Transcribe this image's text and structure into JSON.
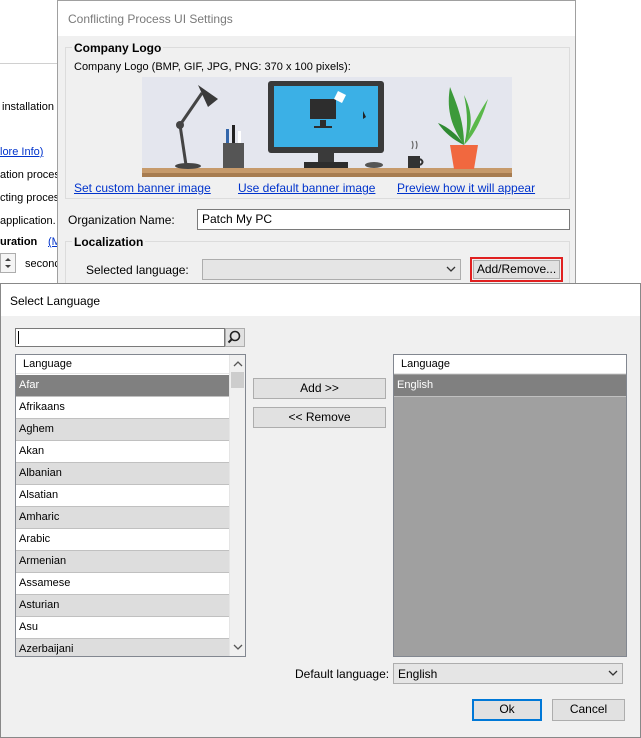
{
  "background_window": {
    "lines": [
      "installation c",
      "ation proces",
      "cting proces",
      "application.",
      "uration",
      "seconc"
    ],
    "more_info_link": "lore Info)",
    "m_link": "(M"
  },
  "conflicting_window": {
    "title": "Conflicting Process UI Settings",
    "company_logo_group": "Company Logo",
    "logo_caption": "Company Logo (BMP, GIF, JPG, PNG: 370 x 100 pixels):",
    "links": {
      "set_custom": "Set custom banner image",
      "use_default": "Use default banner image",
      "preview": "Preview how it will appear"
    },
    "org_label": "Organization Name:",
    "org_value": "Patch My PC",
    "localization_group": "Localization",
    "selected_language_label": "Selected language:",
    "selected_language_value": "",
    "add_remove_button": "Add/Remove..."
  },
  "select_language": {
    "title": "Select Language",
    "search_value": "",
    "available": {
      "header": "Language",
      "items": [
        "Afar",
        "Afrikaans",
        "Aghem",
        "Akan",
        "Albanian",
        "Alsatian",
        "Amharic",
        "Arabic",
        "Armenian",
        "Assamese",
        "Asturian",
        "Asu",
        "Azerbaijani"
      ],
      "selected": "Afar"
    },
    "add_button": "Add >>",
    "remove_button": "<< Remove",
    "chosen": {
      "header": "Language",
      "items": [
        "English"
      ]
    },
    "default_language_label": "Default language:",
    "default_language_value": "English",
    "ok_button": "Ok",
    "cancel_button": "Cancel"
  },
  "colors": {
    "link": "#0033cc",
    "selected_row": "#808080",
    "highlight_border": "#e02020",
    "ok_border": "#0078d7"
  }
}
